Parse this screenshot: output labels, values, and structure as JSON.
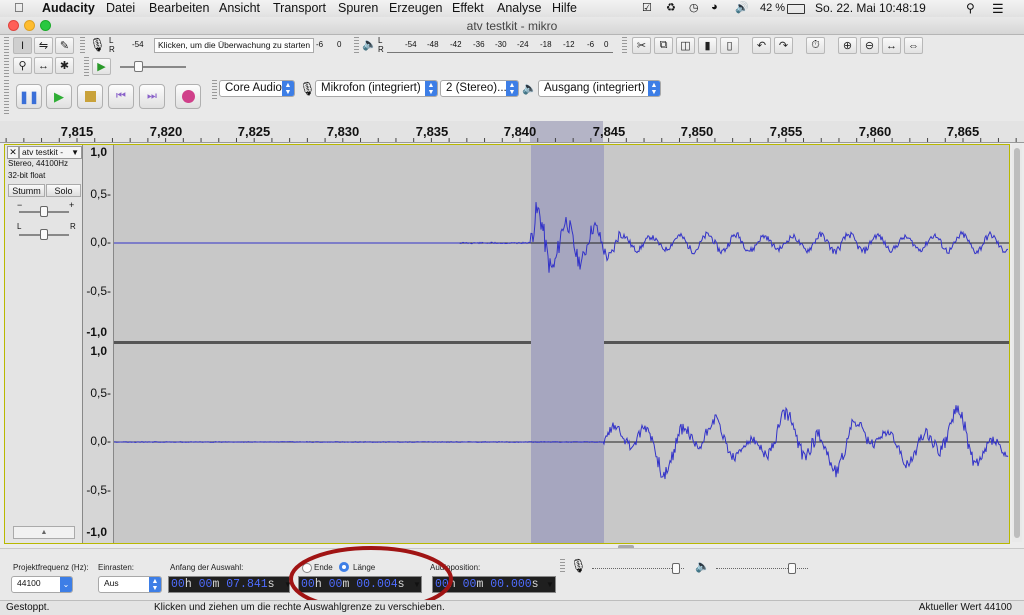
{
  "menubar": {
    "app": "Audacity",
    "items": [
      "Datei",
      "Bearbeiten",
      "Ansicht",
      "Transport",
      "Spuren",
      "Erzeugen",
      "Effekt",
      "Analyse",
      "Hilfe"
    ],
    "battery": "42 %",
    "clock": "So. 22. Mai  10:48:19"
  },
  "window": {
    "title": "atv testkit - mikro"
  },
  "meter": {
    "record_hint": "Klicken, um die Überwachung zu starten",
    "record_ticks": [
      "-54",
      "-6",
      "0"
    ],
    "play_ticks": [
      "-54",
      "-48",
      "-42",
      "-36",
      "-30",
      "-24",
      "-18",
      "-12",
      "-6",
      "0"
    ],
    "lr": [
      "L",
      "R"
    ]
  },
  "devices": {
    "host": "Core Audio",
    "input": "Mikrofon (integriert)",
    "channels": "2 (Stereo)...",
    "output": "Ausgang (integriert)"
  },
  "ruler": {
    "labels": [
      "7,815",
      "7,820",
      "7,825",
      "7,830",
      "7,835",
      "7,840",
      "7,845",
      "7,850",
      "7,855",
      "7,860",
      "7,865"
    ]
  },
  "track": {
    "name": "atv testkit -",
    "info1": "Stereo, 44100Hz",
    "info2": "32-bit float",
    "mute": "Stumm",
    "solo": "Solo",
    "gain_minus": "−",
    "gain_plus": "+",
    "pan_l": "L",
    "pan_r": "R",
    "y_labels": [
      "1,0",
      "0,5-",
      "0,0-",
      "-0,5-",
      "-1,0"
    ],
    "y_labels2": [
      "1,0",
      "0,5-",
      "0,0-",
      "-0,5-",
      "-1,0"
    ]
  },
  "selection": {
    "rate_label": "Projektfrequenz (Hz):",
    "rate_value": "44100",
    "snap_label": "Einrasten:",
    "snap_value": "Aus",
    "start_label": "Anfang der Auswahl:",
    "radio_end": "Ende",
    "radio_length": "Länge",
    "radio_selected": "Länge",
    "audio_pos_label": "Audioposition:",
    "start_time": {
      "h": "00",
      "m": "00",
      "s": "07.841"
    },
    "length_time": {
      "h": "00",
      "m": "00",
      "s": "00.004"
    },
    "audio_time": {
      "h": "00",
      "m": "00",
      "s": "00.000"
    },
    "unit_h": "h",
    "unit_m": "m",
    "unit_s": "s"
  },
  "status": {
    "state": "Gestoppt.",
    "hint": "Klicken und ziehen um die rechte Auswahlgrenze zu verschieben.",
    "actual": "Aktueller Wert 44100"
  },
  "colors": {
    "waveform": "#3232c8",
    "selection": "#a6a6bf",
    "track_bg": "#c8c8c8",
    "timecode_digits": "#4e6cff",
    "annotation": "#a01414"
  },
  "icons": [
    "apple-icon",
    "screen-icon",
    "time-machine-icon",
    "wifi-icon",
    "volume-icon",
    "battery-icon",
    "search-icon",
    "list-icon",
    "microphone-icon",
    "speaker-icon",
    "pause-icon",
    "play-icon",
    "stop-icon",
    "skip-start-icon",
    "skip-end-icon",
    "record-icon"
  ]
}
